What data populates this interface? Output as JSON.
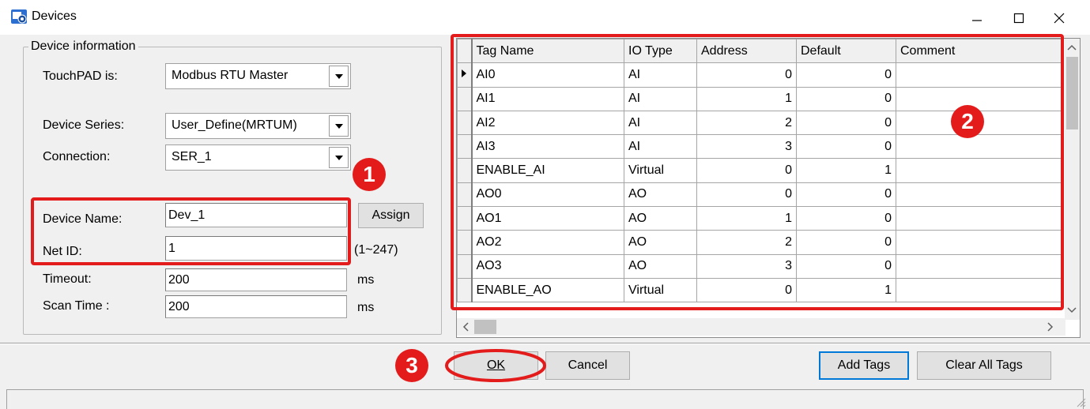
{
  "window": {
    "title": "Devices",
    "minimize_glyph": "—",
    "maximize_glyph": "☐",
    "close_glyph": "✕"
  },
  "device_info": {
    "group_label": "Device information",
    "touchpad_label": "TouchPAD is:",
    "touchpad_value": "Modbus RTU Master",
    "series_label": "Device Series:",
    "series_value": "User_Define(MRTUM)",
    "connection_label": "Connection:",
    "connection_value": "SER_1",
    "device_name_label": "Device Name:",
    "device_name_value": "Dev_1",
    "assign_label": "Assign",
    "net_id_label": "Net ID:",
    "net_id_value": "1",
    "net_id_range": "(1~247)",
    "timeout_label": "Timeout:",
    "timeout_value": "200",
    "timeout_unit": "ms",
    "scan_time_label": "Scan Time :",
    "scan_time_value": "200",
    "scan_time_unit": "ms"
  },
  "grid": {
    "columns": [
      "Tag Name",
      "IO Type",
      "Address",
      "Default",
      "Comment"
    ],
    "rows": [
      {
        "tag": "AI0",
        "io": "AI",
        "address": "0",
        "default": "0",
        "comment": ""
      },
      {
        "tag": "AI1",
        "io": "AI",
        "address": "1",
        "default": "0",
        "comment": ""
      },
      {
        "tag": "AI2",
        "io": "AI",
        "address": "2",
        "default": "0",
        "comment": ""
      },
      {
        "tag": "AI3",
        "io": "AI",
        "address": "3",
        "default": "0",
        "comment": ""
      },
      {
        "tag": "ENABLE_AI",
        "io": "Virtual",
        "address": "0",
        "default": "1",
        "comment": ""
      },
      {
        "tag": "AO0",
        "io": "AO",
        "address": "0",
        "default": "0",
        "comment": ""
      },
      {
        "tag": "AO1",
        "io": "AO",
        "address": "1",
        "default": "0",
        "comment": ""
      },
      {
        "tag": "AO2",
        "io": "AO",
        "address": "2",
        "default": "0",
        "comment": ""
      },
      {
        "tag": "AO3",
        "io": "AO",
        "address": "3",
        "default": "0",
        "comment": ""
      },
      {
        "tag": "ENABLE_AO",
        "io": "Virtual",
        "address": "0",
        "default": "1",
        "comment": ""
      }
    ]
  },
  "buttons": {
    "ok": "OK",
    "cancel": "Cancel",
    "add_tags": "Add Tags",
    "clear_all_tags": "Clear All Tags"
  },
  "markers": {
    "one": "1",
    "two": "2",
    "three": "3"
  },
  "colors": {
    "highlight_red": "#e41b1b",
    "dialog_bg": "#f0f0f0",
    "button_bg": "#e1e1e1"
  }
}
